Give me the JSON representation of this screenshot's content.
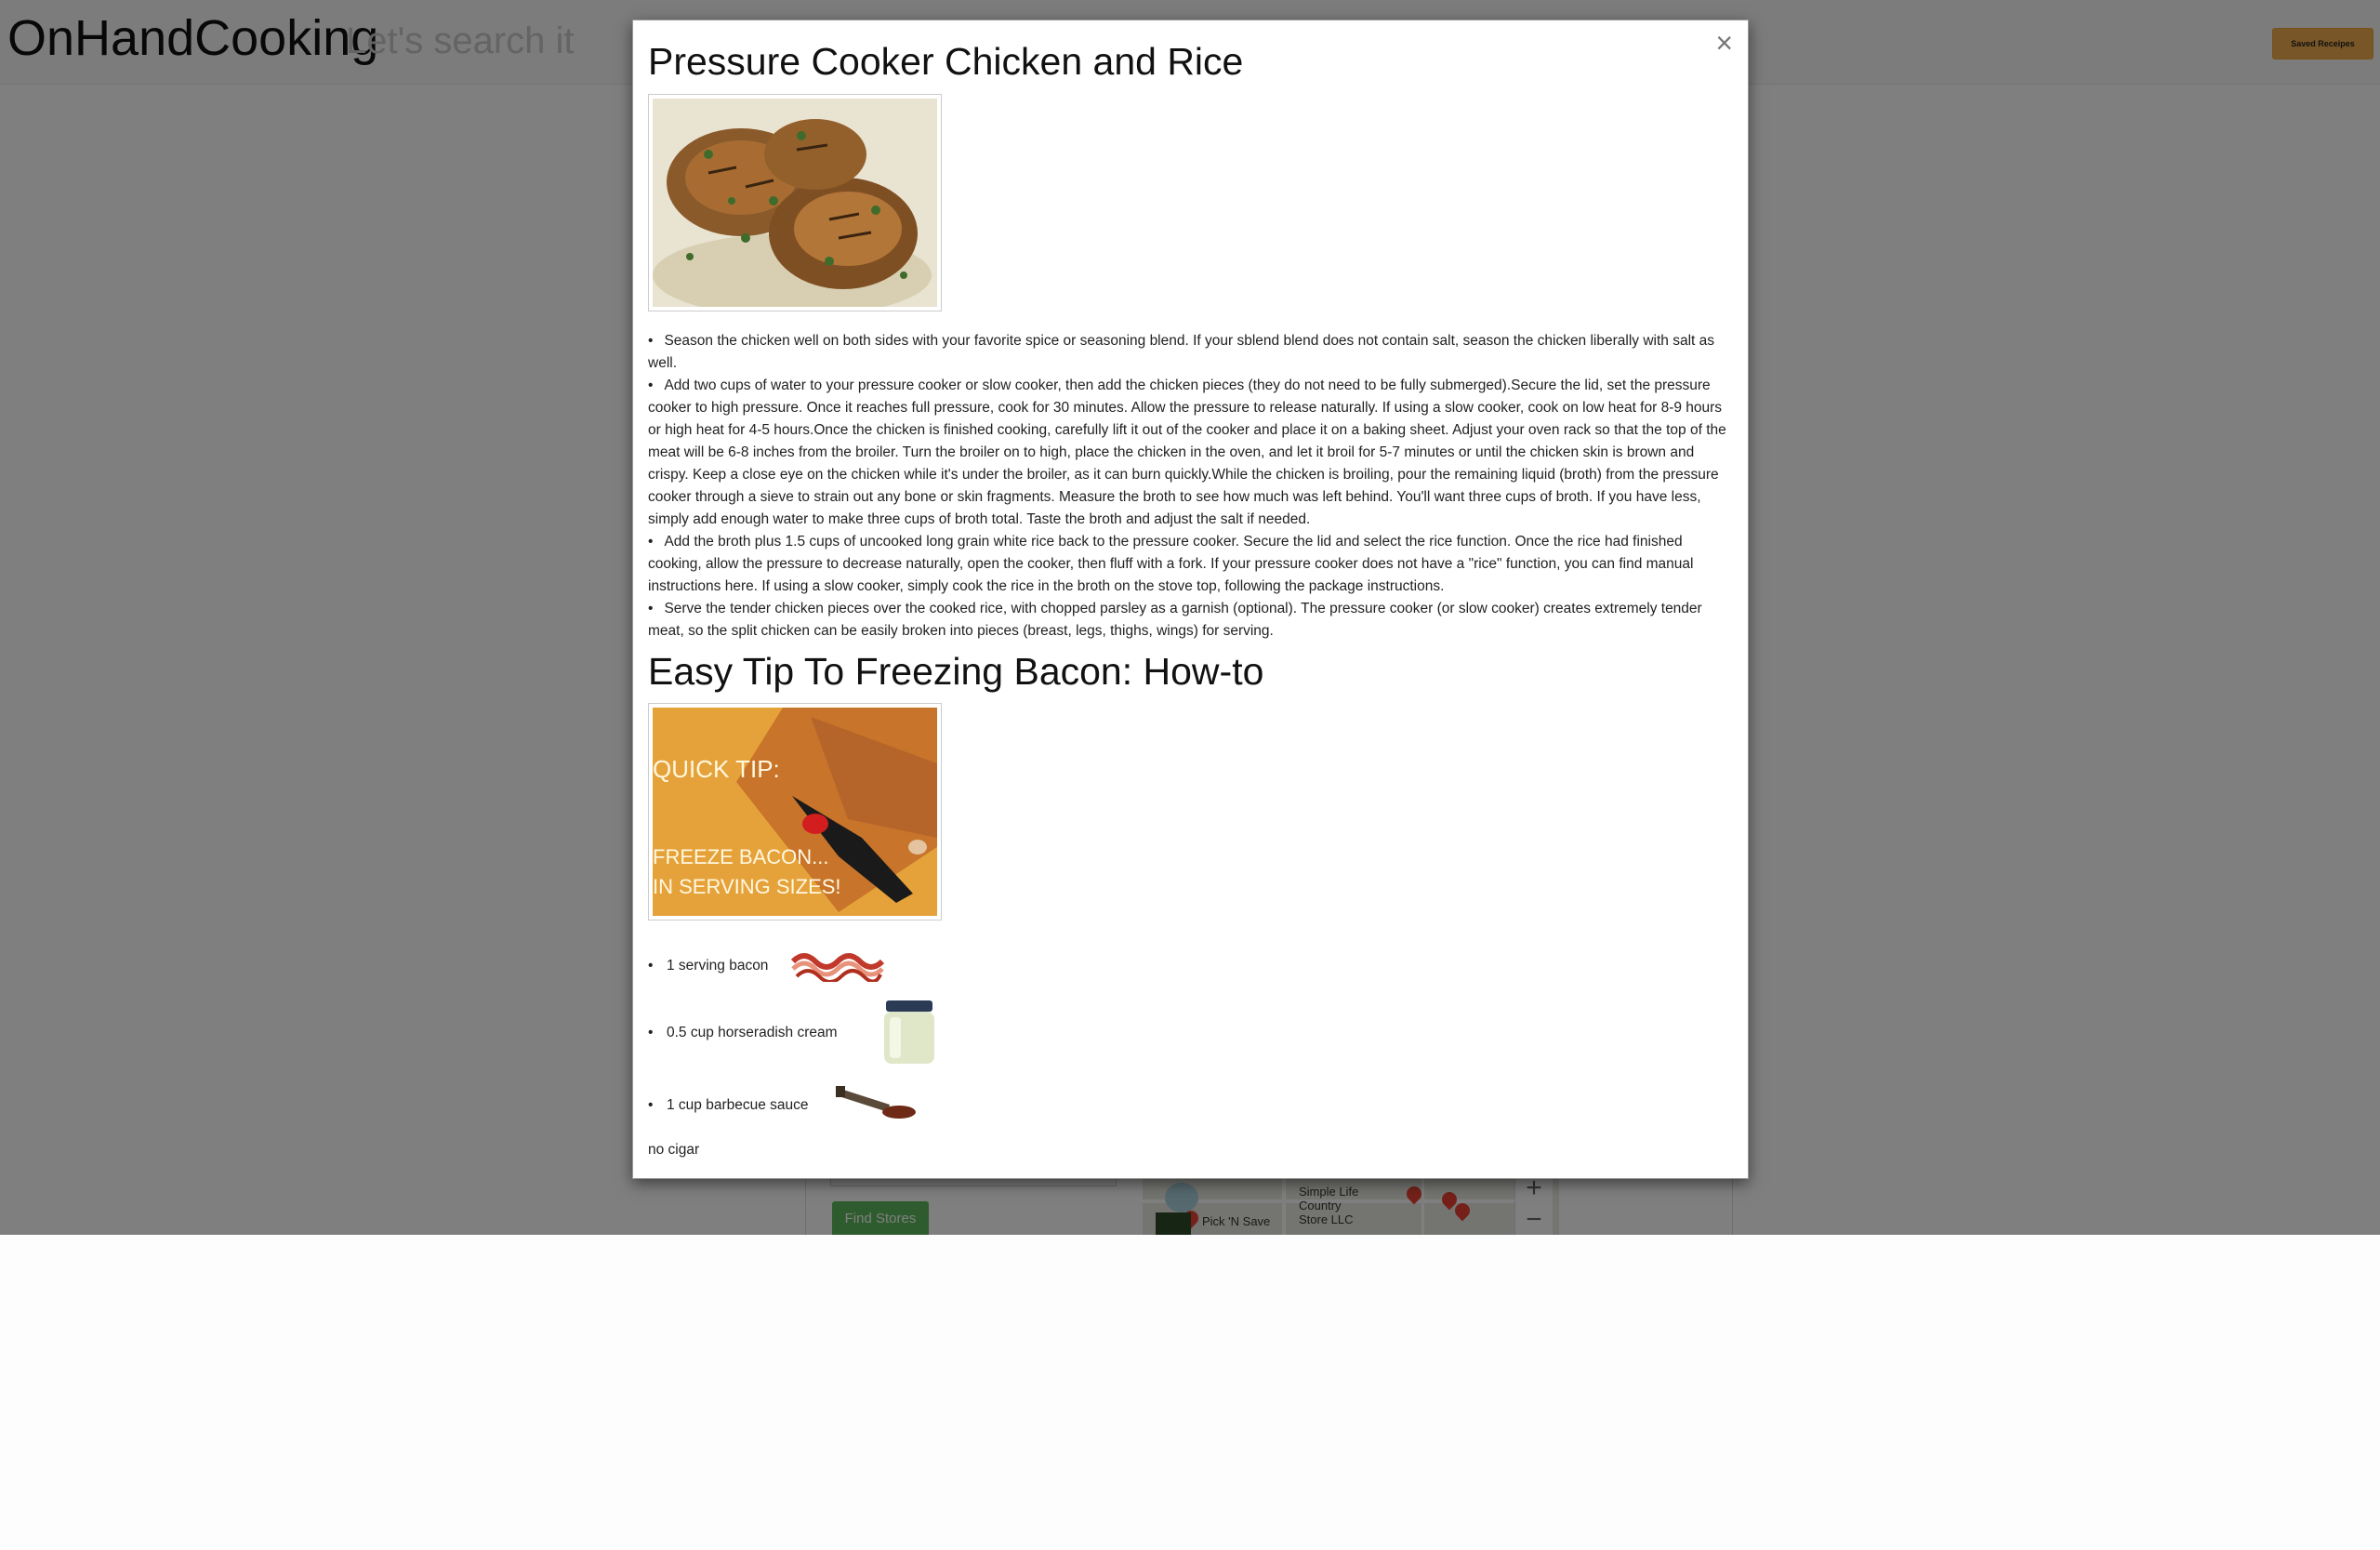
{
  "navbar": {
    "brand": "OnHandCooking",
    "tagline": "Let's search it",
    "saved_button": "Saved Receipes"
  },
  "background": {
    "find_stores_button": "Find Stores",
    "map": {
      "labels": [
        "Simple Life Country Store LLC",
        "Pick 'N Save"
      ],
      "zoom_in": "+",
      "zoom_out": "−"
    }
  },
  "modal": {
    "close_label": "×",
    "recipes": [
      {
        "title": "Pressure Cooker Chicken and Rice",
        "image_icon": "roasted-chicken-photo",
        "steps": [
          "Season the chicken well on both sides with your favorite spice or seasoning blend. If your sblend blend does not contain salt, season the chicken liberally with salt as well.",
          "Add two cups of water to your pressure cooker or slow cooker, then add the chicken pieces (they do not need to be fully submerged).Secure the lid, set the pressure cooker to high pressure. Once it reaches full pressure, cook for 30 minutes. Allow the pressure to release naturally. If using a slow cooker, cook on low heat for 8-9 hours or high heat for 4-5 hours.Once the chicken is finished cooking, carefully lift it out of the cooker and place it on a baking sheet. Adjust your oven rack so that the top of the meat will be 6-8 inches from the broiler. Turn the broiler on to high, place the chicken in the oven, and let it broil for 5-7 minutes or until the chicken skin is brown and crispy. Keep a close eye on the chicken while it's under the broiler, as it can burn quickly.While the chicken is broiling, pour the remaining liquid (broth) from the pressure cooker through a sieve to strain out any bone or skin fragments. Measure the broth to see how much was left behind. You'll want three cups of broth. If you have less, simply add enough water to make three cups of broth total. Taste the broth and adjust the salt if needed.",
          "Add the broth plus 1.5 cups of uncooked long grain white rice back to the pressure cooker. Secure the lid and select the rice function. Once the rice had finished cooking, allow the pressure to decrease naturally, open the cooker, then fluff with a fork. If your pressure cooker does not have a \"rice\" function, you can find manual instructions here. If using a slow cooker, simply cook the rice in the broth on the stove top, following the package instructions.",
          "Serve the tender chicken pieces over the cooked rice, with chopped parsley as a garnish (optional). The pressure cooker (or slow cooker) creates extremely tender meat, so the split chicken can be easily broken into pieces (breast, legs, thighs, wings) for serving."
        ]
      },
      {
        "title": "Easy Tip To Freezing Bacon: How-to",
        "image_icon": "quick-tip-bacon-photo",
        "image_text": [
          "QUICK TIP:",
          "FREEZE BACON...",
          "IN SERVING SIZES!"
        ],
        "ingredients": [
          {
            "text": "1 serving bacon",
            "icon": "bacon-icon"
          },
          {
            "text": "0.5 cup horseradish cream",
            "icon": "jar-icon"
          },
          {
            "text": "1 cup barbecue sauce",
            "icon": "sauce-bottle-icon"
          }
        ]
      }
    ],
    "footer_note": "no cigar"
  }
}
